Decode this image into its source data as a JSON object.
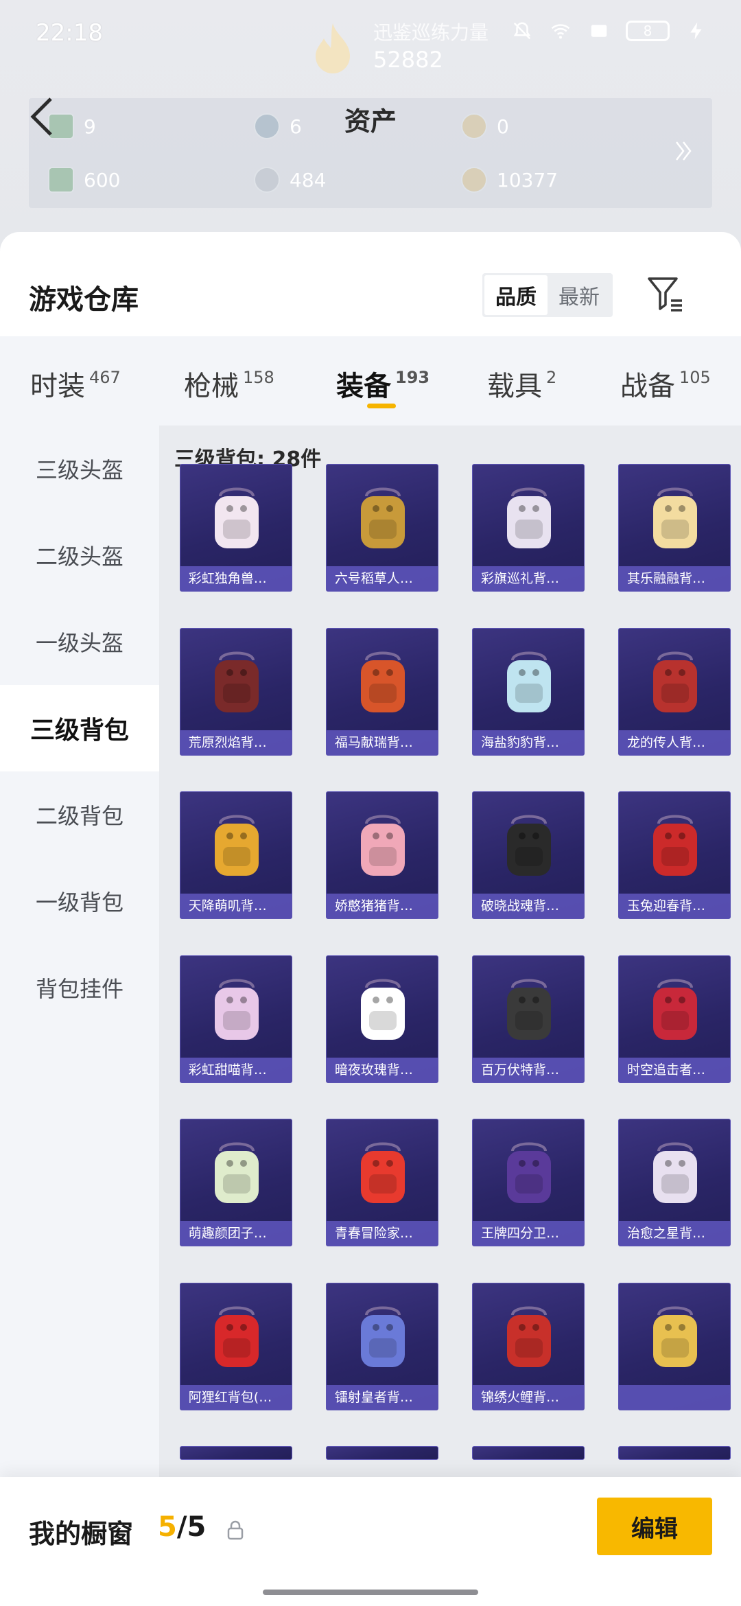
{
  "status_bar": {
    "time": "22:18",
    "battery": "8"
  },
  "header": {
    "event_title": "迅鉴巡练力量",
    "score": "52882",
    "page_title": "资产"
  },
  "assets": [
    {
      "value": "9",
      "icon": "ticket-icon"
    },
    {
      "value": "6",
      "icon": "coin-icon"
    },
    {
      "value": "0",
      "icon": "coin-icon"
    },
    {
      "value": "600",
      "icon": "voucher-icon"
    },
    {
      "value": "484",
      "icon": "coin-icon"
    },
    {
      "value": "10377",
      "icon": "coin-icon"
    }
  ],
  "warehouse": {
    "title": "游戏仓库",
    "sort_quality": "品质",
    "sort_latest": "最新"
  },
  "tabs": [
    {
      "label": "时装",
      "count": "467"
    },
    {
      "label": "枪械",
      "count": "158"
    },
    {
      "label": "装备",
      "count": "193"
    },
    {
      "label": "载具",
      "count": "2"
    },
    {
      "label": "战备",
      "count": "105"
    }
  ],
  "sidebar": [
    {
      "label": "三级头盔"
    },
    {
      "label": "二级头盔"
    },
    {
      "label": "一级头盔"
    },
    {
      "label": "三级背包"
    },
    {
      "label": "二级背包"
    },
    {
      "label": "一级背包"
    },
    {
      "label": "背包挂件"
    }
  ],
  "grid": {
    "caption": "三级背包: 28件",
    "items": [
      "彩虹独角兽…",
      "六号稻草人…",
      "彩旗巡礼背…",
      "其乐融融背…",
      "荒原烈焰背…",
      "福马献瑞背…",
      "海盐豹豹背…",
      "龙的传人背…",
      "天降萌叽背…",
      "娇憨猪猪背…",
      "破晓战魂背…",
      "玉兔迎春背…",
      "彩虹甜喵背…",
      "暗夜玫瑰背…",
      "百万伏特背…",
      "时空追击者…",
      "萌趣颜团子…",
      "青春冒险家…",
      "王牌四分卫…",
      "治愈之星背…",
      "阿狸红背包(…",
      "镭射皇者背…",
      "锦绣火鲤背…",
      ""
    ],
    "colors": [
      "#f2e6f0",
      "#c89a3a",
      "#e8e2f0",
      "#f3dca0",
      "#7a2a2a",
      "#d8552a",
      "#bfe4f0",
      "#b8322e",
      "#e6a830",
      "#f0a8b8",
      "#2a2a2a",
      "#cc2a2a",
      "#e8c8e8",
      "#ffffff",
      "#3a3a3a",
      "#c8283a",
      "#dfeccc",
      "#e83a2e",
      "#5a3a9a",
      "#e8e0f0",
      "#d8282a",
      "#6a7ad8",
      "#c8302a",
      "#e8c050"
    ]
  },
  "bottom": {
    "showcase_title": "我的橱窗",
    "showcase_current": "5",
    "showcase_total": "/5",
    "edit_label": "编辑"
  }
}
